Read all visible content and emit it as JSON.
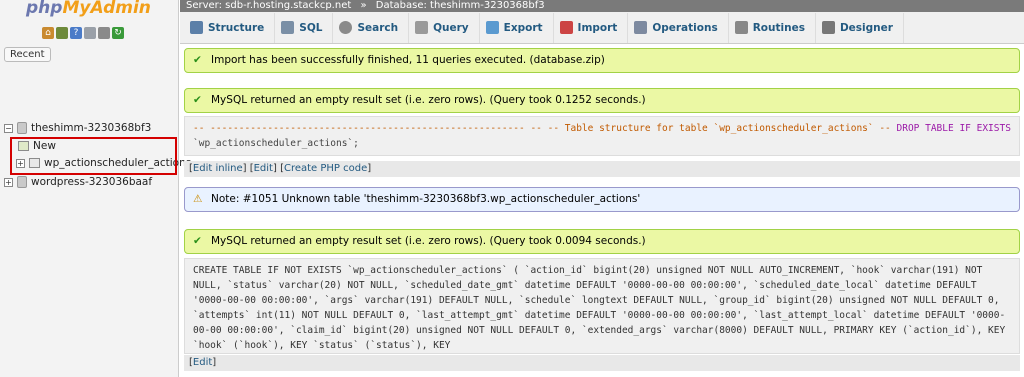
{
  "nav": {
    "logo_php": "php",
    "logo_admin": "MyAdmin",
    "recent_label": "Recent",
    "tree": [
      {
        "label": "theshimm-3230368bf3",
        "expander": "−"
      },
      {
        "label": "New"
      },
      {
        "label": "wp_actionscheduler_actions",
        "expander": "+"
      },
      {
        "label": "wordpress-323036baaf",
        "expander": "+"
      }
    ]
  },
  "topbar": {
    "server": "Server: sdb-r.hosting.stackcp.net",
    "separator": "»",
    "database": "Database: theshimm-3230368bf3"
  },
  "tabs": [
    {
      "label": "Structure",
      "icon": "structure-icon",
      "color": "#5b7fa8"
    },
    {
      "label": "SQL",
      "icon": "sql-icon",
      "color": "#7a8fa6"
    },
    {
      "label": "Search",
      "icon": "search-icon",
      "color": "#8a8a8a"
    },
    {
      "label": "Query",
      "icon": "query-icon",
      "color": "#9a9a9a"
    },
    {
      "label": "Export",
      "icon": "export-icon",
      "color": "#5a9ad0"
    },
    {
      "label": "Import",
      "icon": "import-icon",
      "color": "#c44"
    },
    {
      "label": "Operations",
      "icon": "wrench-icon",
      "color": "#7d8aa0"
    },
    {
      "label": "Routines",
      "icon": "routines-icon",
      "color": "#888"
    },
    {
      "label": "Designer",
      "icon": "designer-icon",
      "color": "#777"
    }
  ],
  "messages": {
    "import_success": "Import has been successfully finished, 11 queries executed. (database.zip)",
    "result1": "MySQL returned an empty result set (i.e. zero rows). (Query took 0.1252 seconds.)",
    "note": "Note: #1051 Unknown table 'theshimm-3230368bf3.wp_actionscheduler_actions'",
    "result2": "MySQL returned an empty result set (i.e. zero rows). (Query took 0.0094 seconds.)"
  },
  "sql1": {
    "comment": "-- ------------------------------------------------------- -- -- Table structure for table `wp_actionscheduler_actions` -- ",
    "drop": "DROP TABLE",
    "if_exists": "IF EXISTS",
    "rest": " `wp_actionscheduler_actions`;"
  },
  "links1": {
    "open": "[",
    "edit_inline": "Edit inline",
    "mid1": "] [",
    "edit": "Edit",
    "mid2": "] [",
    "create_php": "Create PHP code",
    "close": "]"
  },
  "sql2": "CREATE TABLE IF NOT EXISTS `wp_actionscheduler_actions` ( `action_id` bigint(20) unsigned NOT NULL AUTO_INCREMENT, `hook` varchar(191) NOT NULL, `status` varchar(20) NOT NULL, `scheduled_date_gmt` datetime DEFAULT '0000-00-00 00:00:00', `scheduled_date_local` datetime DEFAULT '0000-00-00 00:00:00', `args` varchar(191) DEFAULT NULL, `schedule` longtext DEFAULT NULL, `group_id` bigint(20) unsigned NOT NULL DEFAULT 0, `attempts` int(11) NOT NULL DEFAULT 0, `last_attempt_gmt` datetime DEFAULT '0000-00-00 00:00:00', `last_attempt_local` datetime DEFAULT '0000-00-00 00:00:00', `claim_id` bigint(20) unsigned NOT NULL DEFAULT 0, `extended_args` varchar(8000) DEFAULT NULL, PRIMARY KEY (`action_id`), KEY `hook` (`hook`), KEY `status` (`status`), KEY",
  "links2": {
    "open": "[",
    "edit": "Edit",
    "close": "]"
  }
}
